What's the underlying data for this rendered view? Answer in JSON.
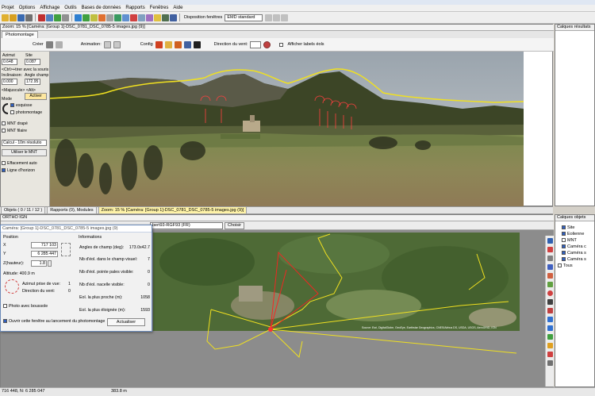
{
  "menu": [
    "Projet",
    "Options",
    "Affichage",
    "Outils",
    "Bases de données",
    "Rapports",
    "Fenêtres",
    "Aide"
  ],
  "toolbar": {
    "layout_label": "Disposition fenêtres",
    "layout_value": "EMD standard"
  },
  "photo_window": {
    "title": "Zoom: 15 % [Caméra: [Group 1]-DSC_0781_DSC_0785-5 images.jpg (9)]",
    "tab": "Photomontage",
    "create_label": "Créer",
    "animation_label": "Animation:",
    "config_label": "Config",
    "wind_label": "Direction du vent:",
    "labels_checkbox": "Afficher labels éols"
  },
  "left_panel": {
    "azimut_label": "Azimut",
    "site_label": "Site",
    "azimut_value": "0.648",
    "site_value": "0.087",
    "ctrl_hint": "<Ctrl>+tirer avec la souris",
    "inclinaison_label": "Inclinaison:",
    "angle_label": "Angle champ",
    "inclinaison_value": "0.000",
    "angle_value": "172.95",
    "maj_hint": "<Majuscule> <Alt>",
    "activate_button": "Activer",
    "mode_label": "Mode",
    "mode_sketch": "esquisse",
    "mode_photo": "photomontage",
    "mnt_drape": "MNT drapé",
    "mnt_filaire": "MNT filaire",
    "calcul_select": "Calcul - 10m résolutio",
    "use_mnt_button": "Utiliser le MNT",
    "auto_erase": "Effacement auto",
    "horizon_line": "Ligne d'horizon"
  },
  "right_top_panel": {
    "title": "Calques résultats"
  },
  "right_bottom_panel": {
    "title": "Calques objets",
    "items": [
      "Site",
      "Eolienne",
      "MNT",
      "Caméra c",
      "Caméra s",
      "Caméra s",
      "Tous"
    ]
  },
  "bottom_tabs": [
    "Objets ( 0 / 11 / 12 )",
    "Rapports (0), Modules",
    "Zoom: 15 % [Caméra: [Group 1]-DSC_0781_DSC_0785-5 images.jpg (9)]"
  ],
  "map_window": {
    "title": "ORTHO IGN",
    "crs_value": "bert93-RGF93 (FR)",
    "choose_button": "Choisir",
    "attribution": "Source: Esri, DigitalGlobe, GeoEye, Earthstar Geographics, CNES/Airbus DS, USDA, USGS, AeroGRID, IGN"
  },
  "dialog": {
    "title": "Caméra: [Group 1]-DSC_0781_DSC_0785-5 images.jpg (9)",
    "position_label": "Position",
    "x_label": "X",
    "x_value": "717 103",
    "y_label": "Y",
    "y_value": "6 285 447",
    "z_label": "Z(hauteur):",
    "z_value": "1.8",
    "altitude_label": "Altitude: 400.9 m",
    "azimut_label": "Azimut prise de vue:",
    "azimut_value": "1",
    "wind_label": "Direction du vent:",
    "wind_value": "0",
    "compass_checkbox": "Photo avec boussole",
    "startup_checkbox": "Ouvrir cette fenêtre au lancement du photomontage",
    "update_button": "Actualiser",
    "info_label": "Informations",
    "info": [
      {
        "label": "Angles de champ (deg):",
        "value": "173.0x42.7"
      },
      {
        "label": "Nb d'éol. dans le champ visuel:",
        "value": "7"
      },
      {
        "label": "Nb d'éol. pointe pales visible:",
        "value": "0"
      },
      {
        "label": "Nb d'éol. nacelle visible:",
        "value": "0"
      },
      {
        "label": "Eol. la plus proche (m):",
        "value": "1058"
      },
      {
        "label": "Eol. la plus éloignée (m):",
        "value": "1593"
      }
    ]
  },
  "status": {
    "coords": "716 448, N: 6 285 047",
    "altitude": "383.8 m"
  }
}
